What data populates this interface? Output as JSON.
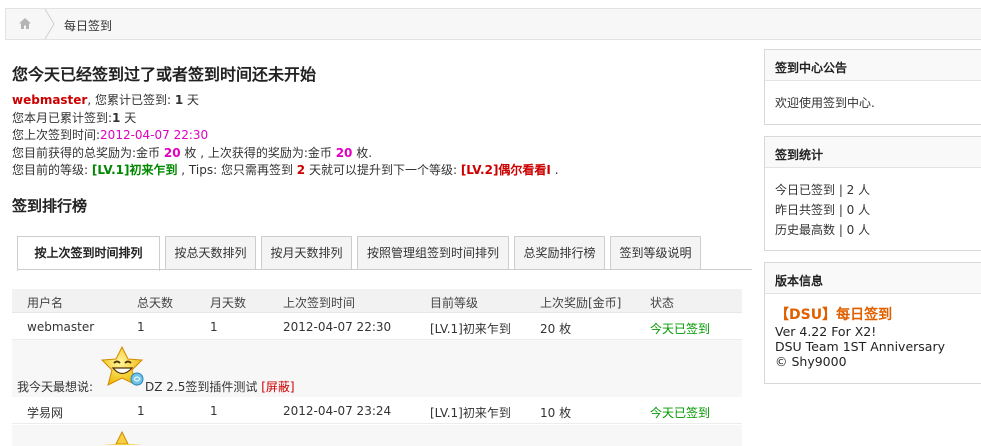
{
  "breadcrumb": {
    "title": "每日签到"
  },
  "main": {
    "headline": "您今天已经签到过了或者签到时间还未开始",
    "user": "webmaster",
    "total_signed_prefix": ", 您累计已签到: ",
    "total_signed_value": "1",
    "total_signed_unit": " 天",
    "month_prefix": "您本月已累计签到:",
    "month_value": "1",
    "month_unit": " 天",
    "last_time_prefix": "您上次签到时间:",
    "last_time_value": "2012-04-07 22:30",
    "reward_prefix": "您目前获得的总奖励为:金币 ",
    "reward_total": "20",
    "reward_mid": " 枚 , 上次获得的奖励为:金币 ",
    "reward_last": "20",
    "reward_unit": " 枚.",
    "level_prefix": "您目前的等级: ",
    "level_current": "[LV.1]初来乍到",
    "level_mid": " , Tips: 您只需再签到 ",
    "level_days": "2",
    "level_mid2": " 天就可以提升到下一个等级: ",
    "level_next": "[LV.2]偶尔看看I",
    "level_end": " ."
  },
  "ranking": {
    "title": "签到排行榜",
    "tabs": [
      "按上次签到时间排列",
      "按总天数排列",
      "按月天数排列",
      "按照管理组签到时间排列",
      "总奖励排行榜",
      "签到等级说明"
    ],
    "columns": [
      "用户名",
      "总天数",
      "月天数",
      "上次签到时间",
      "目前等级",
      "上次奖励[金币]",
      "状态"
    ],
    "rows": [
      {
        "user": "webmaster",
        "total": "1",
        "month": "1",
        "time": "2012-04-07 22:30",
        "level": "[LV.1]初来乍到",
        "reward": "20 枚",
        "status": "今天已签到"
      },
      {
        "user": "学易网",
        "total": "1",
        "month": "1",
        "time": "2012-04-07 23:24",
        "level": "[LV.1]初来乍到",
        "reward": "10 枚",
        "status": "今天已签到"
      }
    ],
    "message": {
      "label": "我今天最想说:",
      "text": "DZ 2.5签到插件测试",
      "block_link": "[屏蔽]"
    }
  },
  "sidebar": {
    "notice": {
      "title": "签到中心公告",
      "text": "欢迎使用签到中心."
    },
    "stats": {
      "title": "签到统计",
      "lines": [
        "今日已签到 | 2 人",
        "昨日共签到 | 0 人",
        "历史最高数 | 0 人"
      ]
    },
    "version": {
      "title": "版本信息",
      "product": "【DSU】每日签到",
      "lines": [
        "Ver 4.22 For X2!",
        "DSU Team 1ST Anniversary",
        "© Shy9000"
      ]
    }
  },
  "colors": {
    "accent_red": "#cc0000",
    "magenta": "#e000c0",
    "green": "#008800",
    "orange": "#e06000"
  }
}
